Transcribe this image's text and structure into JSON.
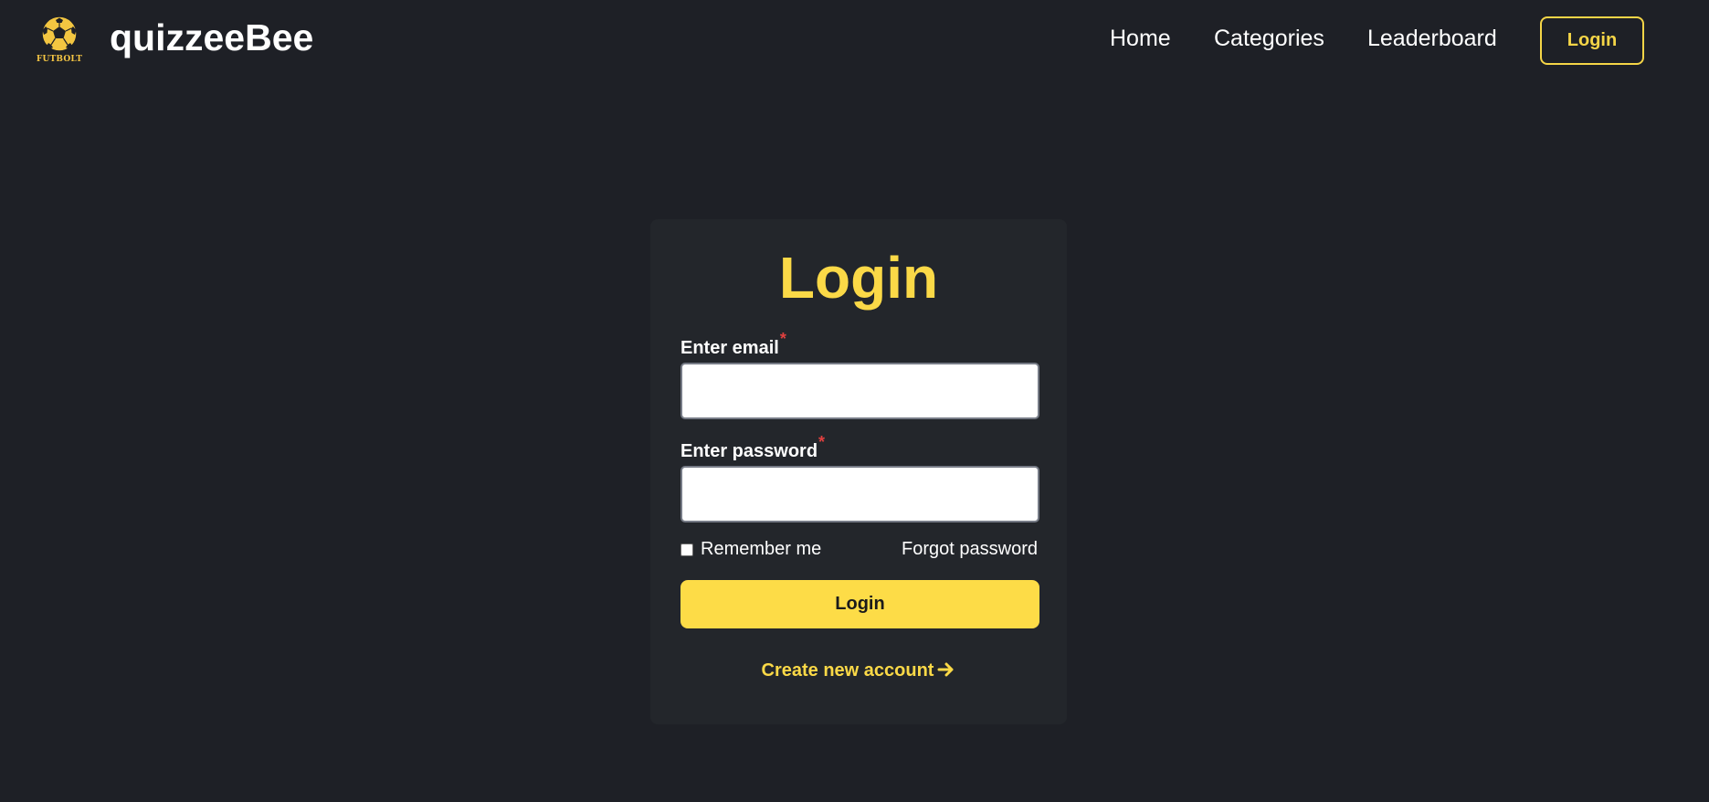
{
  "header": {
    "logo_icon": "soccer-ball-icon",
    "logo_caption": "FUTBOLT",
    "site_name": "quizzeeBee",
    "nav": {
      "home": "Home",
      "categories": "Categories",
      "leaderboard": "Leaderboard",
      "login": "Login"
    }
  },
  "login_form": {
    "title": "Login",
    "email_label": "Enter email",
    "password_label": "Enter password",
    "required_marker": "*",
    "email_value": "",
    "password_value": "",
    "remember_label": "Remember me",
    "remember_checked": false,
    "forgot_label": "Forgot password",
    "submit_label": "Login",
    "create_account_label": "Create new account",
    "create_account_icon": "arrow-right-icon"
  },
  "colors": {
    "background": "#1e2026",
    "card": "#23262b",
    "accent": "#fbd947",
    "required": "#e0403f",
    "text": "#ffffff"
  }
}
